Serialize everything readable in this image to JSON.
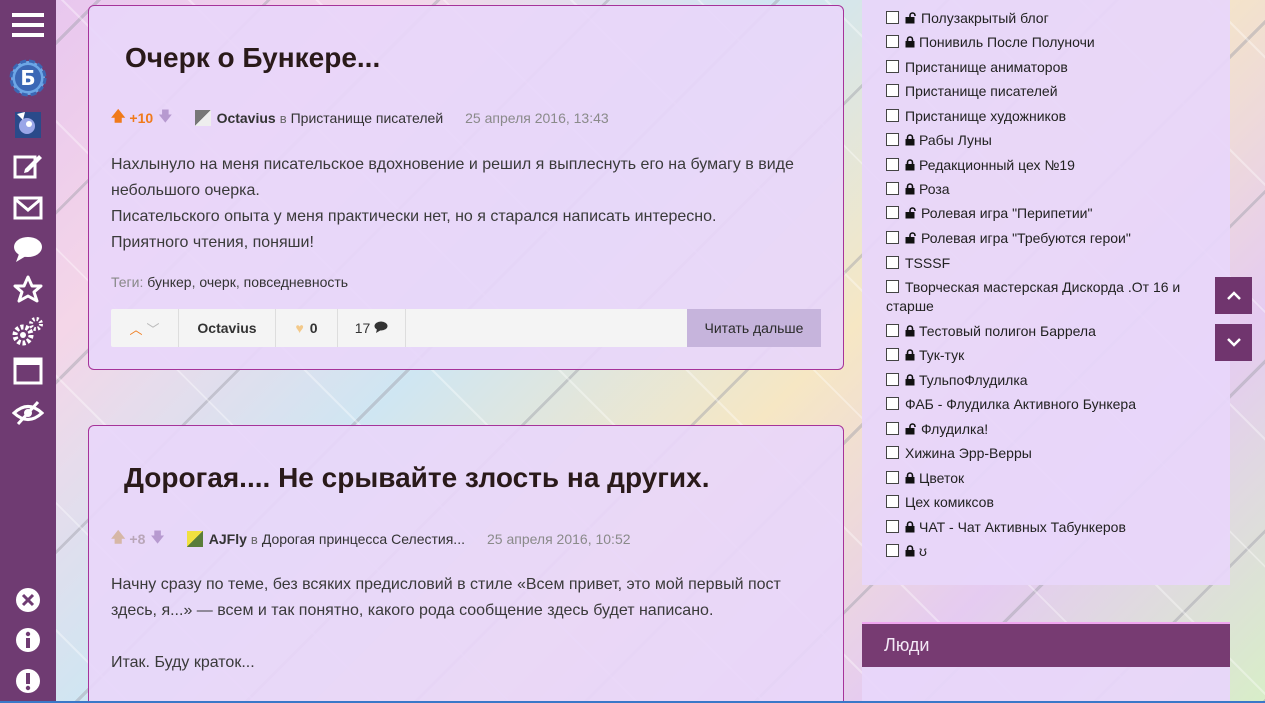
{
  "sidebar": {
    "items": [
      {
        "name": "menu-icon"
      },
      {
        "name": "bunker-logo-icon",
        "label": "Б"
      },
      {
        "name": "pony-avatar-icon"
      },
      {
        "name": "edit-icon"
      },
      {
        "name": "mail-icon"
      },
      {
        "name": "comments-icon"
      },
      {
        "name": "star-icon"
      },
      {
        "name": "settings-icon"
      },
      {
        "name": "window-icon"
      },
      {
        "name": "hide-icon"
      }
    ],
    "bottom_items": [
      {
        "name": "close-circle-icon"
      },
      {
        "name": "info-icon"
      },
      {
        "name": "alert-icon"
      }
    ]
  },
  "posts": [
    {
      "title": "Очерк о Бункере...",
      "rating": "+10",
      "author": "Octavius",
      "in": "в",
      "blog": "Пристанище писателей",
      "date": "25 апреля 2016, 13:43",
      "body": [
        "Нахлынуло на меня писательское вдохновение и решил я выплеснуть его на бумагу в виде небольшого очерка.",
        "Писательского опыта у меня практически нет, но я старался написать интересно.",
        "Приятного чтения, поняши!"
      ],
      "tags_label": "Теги:",
      "tags": [
        "бункер",
        "очерк",
        "повседневность"
      ],
      "footer": {
        "author": "Octavius",
        "favourites": "0",
        "comments": "17",
        "read_more": "Читать дальше"
      }
    },
    {
      "title": "Дорогая.... Не срывайте злость на других.",
      "rating": "+8",
      "author": "AJFly",
      "in": "в",
      "blog": "Дорогая принцесса Селестия...",
      "date": "25 апреля 2016, 10:52",
      "body": [
        "Начну сразу по теме, без всяких предисловий в стиле «Всем привет, это мой первый пост здесь, я...» — всем и так понятно, какого рода сообщение здесь будет написано.",
        "",
        "Итак. Буду краток..."
      ]
    }
  ],
  "blog_list": [
    {
      "label": "Полузакрытый блог",
      "lock": "half"
    },
    {
      "label": "Понивиль После Полуночи",
      "lock": "closed"
    },
    {
      "label": "Пристанище аниматоров",
      "lock": ""
    },
    {
      "label": "Пристанище писателей",
      "lock": ""
    },
    {
      "label": "Пристанище художников",
      "lock": ""
    },
    {
      "label": "Рабы Луны",
      "lock": "closed"
    },
    {
      "label": "Редакционный цех №19",
      "lock": "closed"
    },
    {
      "label": "Роза",
      "lock": "closed"
    },
    {
      "label": "Ролевая игра \"Перипетии\"",
      "lock": "half"
    },
    {
      "label": "Ролевая игра \"Требуются герои\"",
      "lock": "half"
    },
    {
      "label": "TSSSF",
      "lock": ""
    },
    {
      "label": "Творческая мастерская Дискорда .От 16 и старше",
      "lock": ""
    },
    {
      "label": "Тестовый полигон Баррела",
      "lock": "closed"
    },
    {
      "label": "Тук-тук",
      "lock": "closed"
    },
    {
      "label": "ТульпоФлудилка",
      "lock": "closed"
    },
    {
      "label": "ФАБ - Флудилка Активного Бункера",
      "lock": ""
    },
    {
      "label": "Флудилка!",
      "lock": "half"
    },
    {
      "label": "Хижина Эрр-Верры",
      "lock": ""
    },
    {
      "label": "Цветок",
      "lock": "closed"
    },
    {
      "label": "Цех комиксов",
      "lock": ""
    },
    {
      "label": "ЧАТ - Чат Активных Табункеров",
      "lock": "closed"
    },
    {
      "label": "ʊ",
      "lock": "closed"
    }
  ],
  "people": {
    "title": "Люди"
  },
  "colors": {
    "sidebar": "#6f3b72",
    "accent": "#773b72",
    "vote_up": "#f07a1a"
  }
}
